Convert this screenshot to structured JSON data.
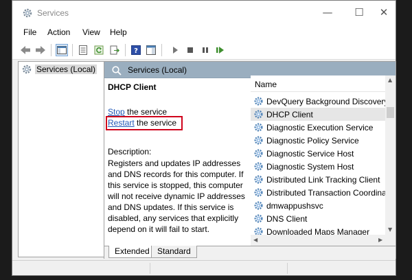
{
  "window": {
    "title": "Services",
    "minimize": "—",
    "maximize": "☐",
    "close": "✕"
  },
  "menu": {
    "file": "File",
    "action": "Action",
    "view": "View",
    "help": "Help"
  },
  "tree": {
    "root": "Services (Local)"
  },
  "pane_header": {
    "title": "Services (Local)"
  },
  "details": {
    "service_name": "DHCP Client",
    "stop_link": "Stop",
    "stop_suffix": " the service",
    "restart_link": "Restart",
    "restart_suffix": " the service",
    "description_label": "Description:",
    "description": "Registers and updates IP addresses and DNS records for this computer. If this service is stopped, this computer will not receive dynamic IP addresses and DNS updates. If this service is disabled, any services that explicitly depend on it will fail to start."
  },
  "list": {
    "column_name": "Name",
    "rows": [
      "DevQuery Background Discovery",
      "DHCP Client",
      "Diagnostic Execution Service",
      "Diagnostic Policy Service",
      "Diagnostic Service Host",
      "Diagnostic System Host",
      "Distributed Link Tracking Client",
      "Distributed Transaction Coordina",
      "dmwappushsvc",
      "DNS Client",
      "Downloaded Maps Manager"
    ],
    "selected_index": 1
  },
  "tabs": {
    "extended": "Extended",
    "standard": "Standard"
  },
  "colors": {
    "header_bg": "#9aaebf",
    "link": "#2158b7",
    "highlight_box": "#d0021b",
    "gear": "#4a7fb5"
  }
}
